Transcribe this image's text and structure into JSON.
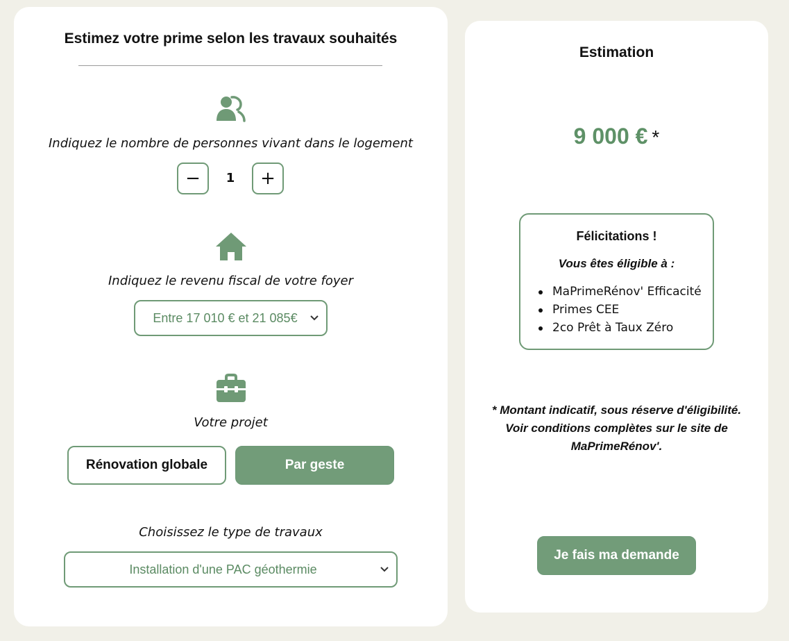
{
  "estimator": {
    "title": "Estimez votre prime selon les travaux souhaités",
    "household": {
      "icon": "users-icon",
      "label": "Indiquez le nombre de personnes vivant dans le logement",
      "count": "1",
      "decrement_symbol": "−",
      "increment_symbol": "+"
    },
    "income": {
      "icon": "house-icon",
      "label": "Indiquez le revenu fiscal de votre foyer",
      "selected": "Entre 17 010 € et 21 085€"
    },
    "project": {
      "icon": "briefcase-icon",
      "label": "Votre projet",
      "options": [
        "Rénovation globale",
        "Par geste"
      ],
      "selected": "Par geste"
    },
    "works": {
      "label": "Choisissez le type de travaux",
      "selected": "Installation d'une PAC géothermie"
    }
  },
  "estimation": {
    "title": "Estimation",
    "amount": "9 000 €",
    "amount_suffix": "*",
    "eligibility": {
      "title": "Félicitations !",
      "subtitle": "Vous êtes éligible à :",
      "items": [
        "MaPrimeRénov' Efficacité",
        "Primes CEE",
        "2co Prêt à Taux Zéro"
      ]
    },
    "disclaimer_lines": [
      "* Montant indicatif, sous réserve d'éligibilité.",
      "Voir conditions complètes sur le site de",
      "MaPrimeRénov'."
    ],
    "cta_label": "Je fais ma demande"
  },
  "colors": {
    "page_background": "#f1f0e8",
    "card_background": "#ffffff",
    "accent_green": "#729c79",
    "amount_green": "#5e9167"
  }
}
